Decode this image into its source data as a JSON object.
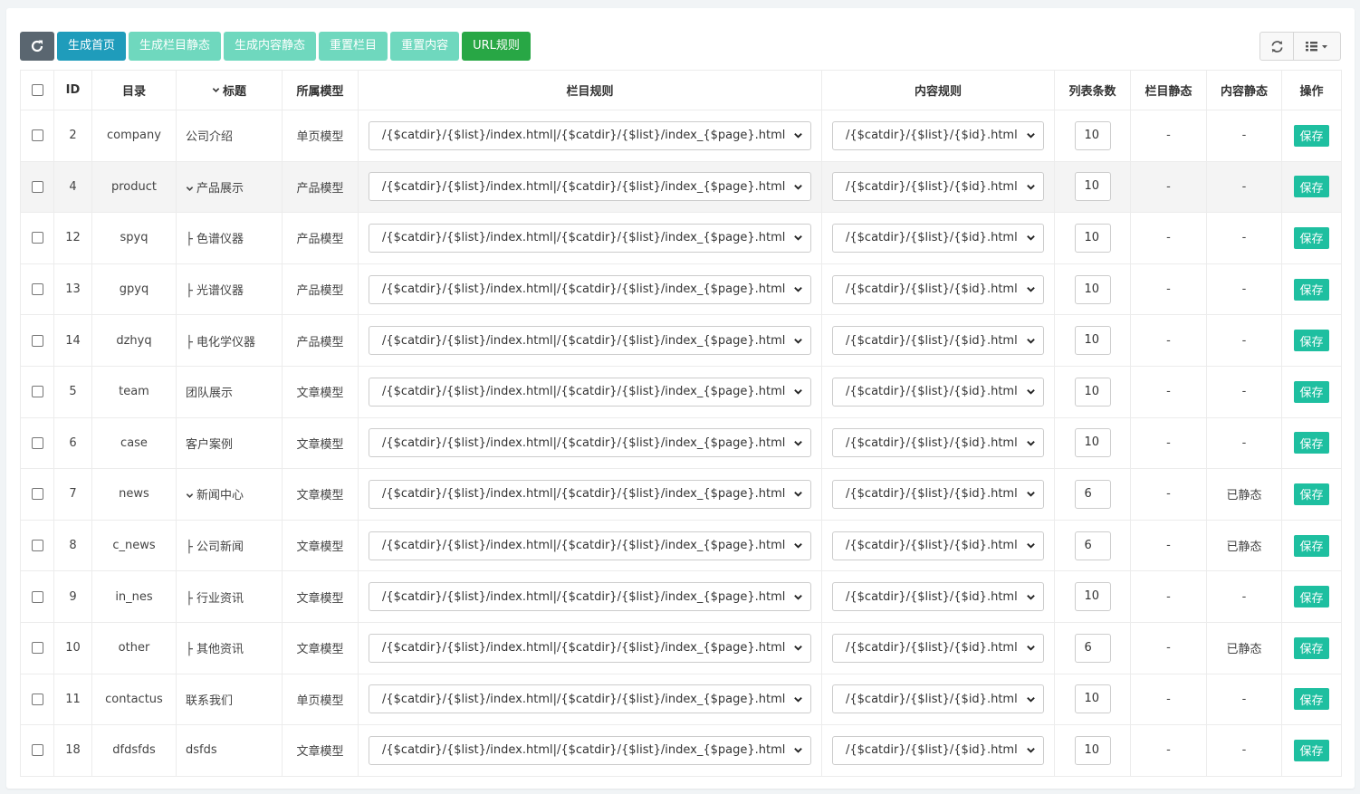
{
  "toolbar": {
    "buttons": [
      {
        "label": "生成首页"
      },
      {
        "label": "生成栏目静态"
      },
      {
        "label": "生成内容静态"
      },
      {
        "label": "重置栏目"
      },
      {
        "label": "重置内容"
      },
      {
        "label": "URL规则"
      }
    ],
    "colors": {
      "info": "#1f9cbb",
      "light": "#6fd8be",
      "success": "#28a745",
      "refresh": "#5a6670",
      "save": "#1ebfa0"
    }
  },
  "table": {
    "headers": {
      "id": "ID",
      "dir": "目录",
      "title": "标题",
      "model": "所属模型",
      "cat_rule": "栏目规则",
      "content_rule": "内容规则",
      "list_count": "列表条数",
      "cat_static": "栏目静态",
      "content_static": "内容静态",
      "action": "操作"
    },
    "save_label": "保存",
    "rows": [
      {
        "id": "2",
        "dir": "company",
        "title": "公司介绍",
        "model": "单页模型",
        "cat_rule": "/{$catdir}/{$list}/index.html|/{$catdir}/{$list}/index_{$page}.html",
        "content_rule": "/{$catdir}/{$list}/{$id}.html",
        "count": "10",
        "cat_static": "-",
        "content_static": "-",
        "chevron": false,
        "highlight": false
      },
      {
        "id": "4",
        "dir": "product",
        "title": "产品展示",
        "model": "产品模型",
        "cat_rule": "/{$catdir}/{$list}/index.html|/{$catdir}/{$list}/index_{$page}.html",
        "content_rule": "/{$catdir}/{$list}/{$id}.html",
        "count": "10",
        "cat_static": "-",
        "content_static": "-",
        "chevron": true,
        "highlight": true
      },
      {
        "id": "12",
        "dir": "spyq",
        "title": "├ 色谱仪器",
        "model": "产品模型",
        "cat_rule": "/{$catdir}/{$list}/index.html|/{$catdir}/{$list}/index_{$page}.html",
        "content_rule": "/{$catdir}/{$list}/{$id}.html",
        "count": "10",
        "cat_static": "-",
        "content_static": "-",
        "chevron": false,
        "highlight": false
      },
      {
        "id": "13",
        "dir": "gpyq",
        "title": "├ 光谱仪器",
        "model": "产品模型",
        "cat_rule": "/{$catdir}/{$list}/index.html|/{$catdir}/{$list}/index_{$page}.html",
        "content_rule": "/{$catdir}/{$list}/{$id}.html",
        "count": "10",
        "cat_static": "-",
        "content_static": "-",
        "chevron": false,
        "highlight": false
      },
      {
        "id": "14",
        "dir": "dzhyq",
        "title": "├ 电化学仪器",
        "model": "产品模型",
        "cat_rule": "/{$catdir}/{$list}/index.html|/{$catdir}/{$list}/index_{$page}.html",
        "content_rule": "/{$catdir}/{$list}/{$id}.html",
        "count": "10",
        "cat_static": "-",
        "content_static": "-",
        "chevron": false,
        "highlight": false
      },
      {
        "id": "5",
        "dir": "team",
        "title": "团队展示",
        "model": "文章模型",
        "cat_rule": "/{$catdir}/{$list}/index.html|/{$catdir}/{$list}/index_{$page}.html",
        "content_rule": "/{$catdir}/{$list}/{$id}.html",
        "count": "10",
        "cat_static": "-",
        "content_static": "-",
        "chevron": false,
        "highlight": false
      },
      {
        "id": "6",
        "dir": "case",
        "title": "客户案例",
        "model": "文章模型",
        "cat_rule": "/{$catdir}/{$list}/index.html|/{$catdir}/{$list}/index_{$page}.html",
        "content_rule": "/{$catdir}/{$list}/{$id}.html",
        "count": "10",
        "cat_static": "-",
        "content_static": "-",
        "chevron": false,
        "highlight": false
      },
      {
        "id": "7",
        "dir": "news",
        "title": "新闻中心",
        "model": "文章模型",
        "cat_rule": "/{$catdir}/{$list}/index.html|/{$catdir}/{$list}/index_{$page}.html",
        "content_rule": "/{$catdir}/{$list}/{$id}.html",
        "count": "6",
        "cat_static": "-",
        "content_static": "已静态",
        "chevron": true,
        "highlight": false
      },
      {
        "id": "8",
        "dir": "c_news",
        "title": "├ 公司新闻",
        "model": "文章模型",
        "cat_rule": "/{$catdir}/{$list}/index.html|/{$catdir}/{$list}/index_{$page}.html",
        "content_rule": "/{$catdir}/{$list}/{$id}.html",
        "count": "6",
        "cat_static": "-",
        "content_static": "已静态",
        "chevron": false,
        "highlight": false
      },
      {
        "id": "9",
        "dir": "in_nes",
        "title": "├ 行业资讯",
        "model": "文章模型",
        "cat_rule": "/{$catdir}/{$list}/index.html|/{$catdir}/{$list}/index_{$page}.html",
        "content_rule": "/{$catdir}/{$list}/{$id}.html",
        "count": "10",
        "cat_static": "-",
        "content_static": "-",
        "chevron": false,
        "highlight": false
      },
      {
        "id": "10",
        "dir": "other",
        "title": "├ 其他资讯",
        "model": "文章模型",
        "cat_rule": "/{$catdir}/{$list}/index.html|/{$catdir}/{$list}/index_{$page}.html",
        "content_rule": "/{$catdir}/{$list}/{$id}.html",
        "count": "6",
        "cat_static": "-",
        "content_static": "已静态",
        "chevron": false,
        "highlight": false
      },
      {
        "id": "11",
        "dir": "contactus",
        "title": "联系我们",
        "model": "单页模型",
        "cat_rule": "/{$catdir}/{$list}/index.html|/{$catdir}/{$list}/index_{$page}.html",
        "content_rule": "/{$catdir}/{$list}/{$id}.html",
        "count": "10",
        "cat_static": "-",
        "content_static": "-",
        "chevron": false,
        "highlight": false
      },
      {
        "id": "18",
        "dir": "dfdsfds",
        "title": "dsfds",
        "model": "文章模型",
        "cat_rule": "/{$catdir}/{$list}/index.html|/{$catdir}/{$list}/index_{$page}.html",
        "content_rule": "/{$catdir}/{$list}/{$id}.html",
        "count": "10",
        "cat_static": "-",
        "content_static": "-",
        "chevron": false,
        "highlight": false
      }
    ]
  }
}
